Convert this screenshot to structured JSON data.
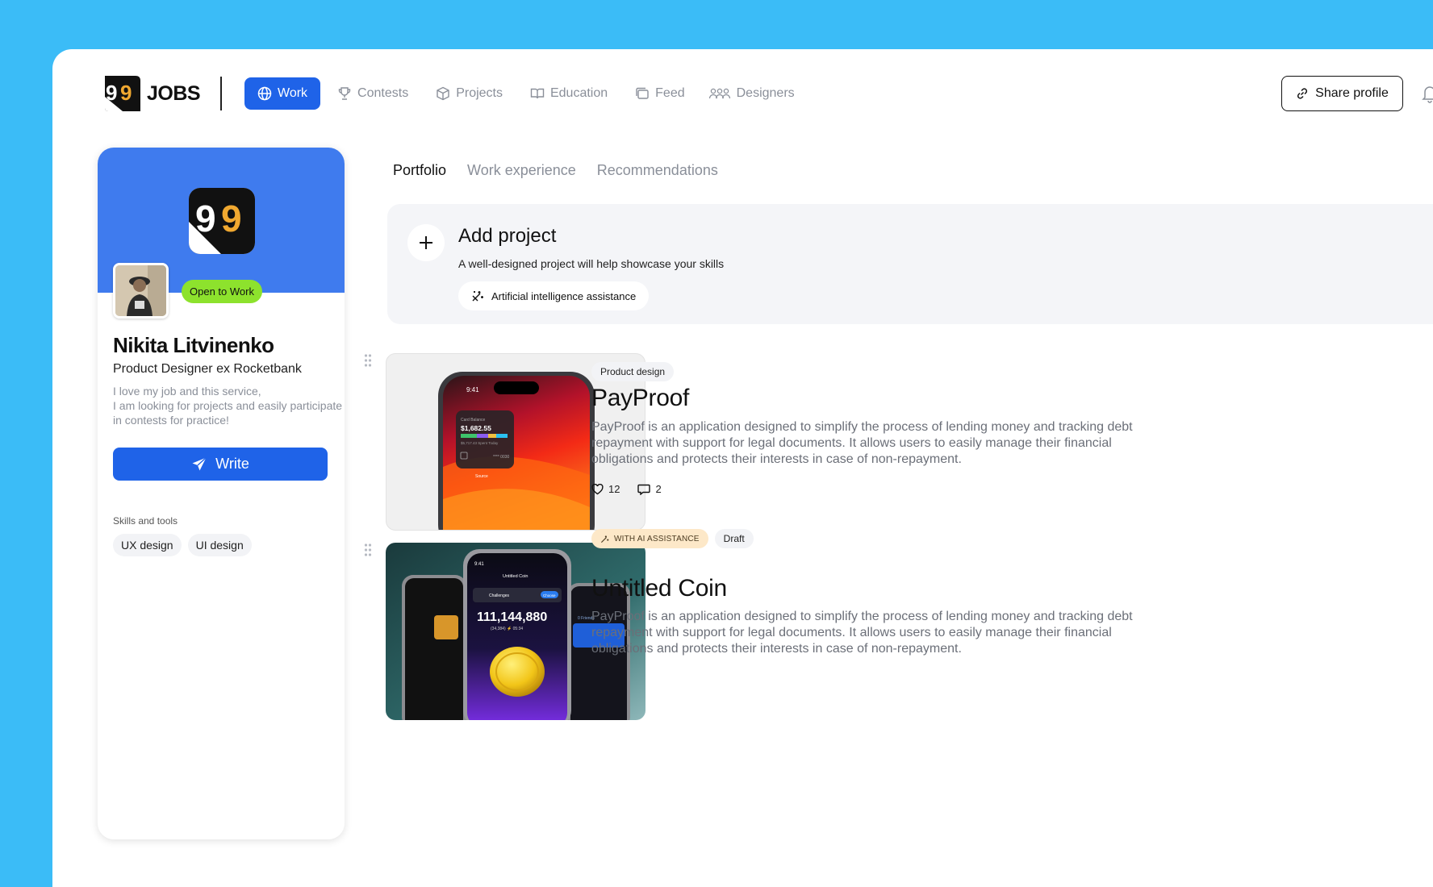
{
  "brand": {
    "name": "JOBS",
    "logo_icon": "99-logo-icon"
  },
  "nav": {
    "items": [
      {
        "label": "Work",
        "icon": "globe-icon",
        "active": true
      },
      {
        "label": "Contests",
        "icon": "trophy-icon"
      },
      {
        "label": "Projects",
        "icon": "cube-icon"
      },
      {
        "label": "Education",
        "icon": "book-icon"
      },
      {
        "label": "Feed",
        "icon": "cards-icon"
      },
      {
        "label": "Designers",
        "icon": "people-icon"
      }
    ],
    "share_label": "Share profile"
  },
  "profile": {
    "badge": "Open to Work",
    "name": "Nikita Litvinenko",
    "role": "Product Designer ex Rocketbank",
    "bio": "I love my job and this service,\nI am looking for projects and easily participate\nin contests for practice!",
    "write_label": "Write",
    "skills_title": "Skills and tools",
    "skills": [
      "UX design",
      "UI design"
    ]
  },
  "tabs": [
    {
      "label": "Portfolio",
      "active": true
    },
    {
      "label": "Work experience"
    },
    {
      "label": "Recommendations"
    }
  ],
  "add_project": {
    "title": "Add project",
    "description": "A well-designed project will help showcase your skills",
    "ai_label": "Artificial intelligence assistance"
  },
  "projects": [
    {
      "tags": [
        "Product design"
      ],
      "title": "PayProof",
      "description": "PayProof is an application designed to simplify the process of lending money and tracking debt repayment with support for legal documents. It allows users to easily manage their financial obligations and protects their interests in case of non-repayment.",
      "likes": "12",
      "comments": "2",
      "mock": {
        "time": "9:41",
        "card_label": "Card Balance",
        "balance": "$1,682.55",
        "spent": "$5,717.43 Spent Today",
        "card_number": "**** 0030",
        "action": "Source"
      }
    },
    {
      "ai_tag": "WITH AI ASSISTANCE",
      "tags": [
        "Draft"
      ],
      "title": "Untitled Coin",
      "description": "PayProof is an application designed to simplify the process of lending money and tracking debt repayment with support for legal documents. It allows users to easily manage their financial obligations and protects their interests in case of non-repayment.",
      "mock": {
        "time": "9:41",
        "app_title": "Untitled Coin",
        "challenge": "Challenges",
        "choose": "Choose",
        "score": "111,144,880",
        "sub": "(34,384) ⚡ 05:34",
        "friends": "0 Friends"
      }
    }
  ],
  "colors": {
    "accent": "#1f63e8",
    "cover": "#3f7bee",
    "badge": "#8de22d",
    "background": "#3bbcf7"
  }
}
